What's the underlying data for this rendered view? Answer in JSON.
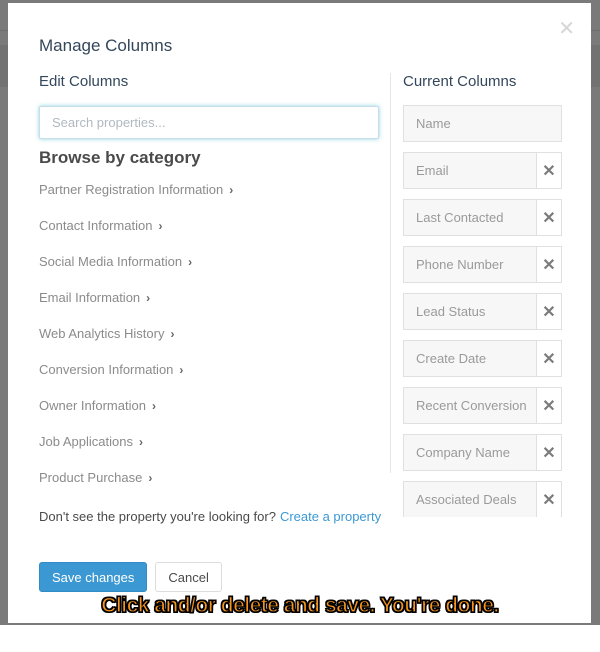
{
  "modal": {
    "title": "Manage Columns",
    "close_icon": "close-icon"
  },
  "edit": {
    "heading": "Edit Columns",
    "search_placeholder": "Search properties...",
    "browse_heading": "Browse by category",
    "categories": [
      {
        "label": "Partner Registration Information"
      },
      {
        "label": "Contact Information"
      },
      {
        "label": "Social Media Information"
      },
      {
        "label": "Email Information"
      },
      {
        "label": "Web Analytics History"
      },
      {
        "label": "Conversion Information"
      },
      {
        "label": "Owner Information"
      },
      {
        "label": "Job Applications"
      },
      {
        "label": "Product Purchase"
      }
    ],
    "chevron": "›",
    "dont_see_text": "Don't see the property you're looking for?",
    "create_link": "Create a property"
  },
  "current": {
    "heading": "Current Columns",
    "columns": [
      {
        "label": "Name",
        "removable": false
      },
      {
        "label": "Email",
        "removable": true
      },
      {
        "label": "Last Contacted",
        "removable": true
      },
      {
        "label": "Phone Number",
        "removable": true
      },
      {
        "label": "Lead Status",
        "removable": true
      },
      {
        "label": "Create Date",
        "removable": true
      },
      {
        "label": "Recent Conversion",
        "removable": true
      },
      {
        "label": "Company Name",
        "removable": true
      },
      {
        "label": "Associated Deals",
        "removable": true
      }
    ],
    "remove_glyph": "✕"
  },
  "footer": {
    "save_label": "Save changes",
    "cancel_label": "Cancel"
  },
  "caption": "Click and/or delete and save. You're done.",
  "colors": {
    "primary": "#3b98d2",
    "link": "#3b99d6",
    "caption": "#f7941d"
  }
}
